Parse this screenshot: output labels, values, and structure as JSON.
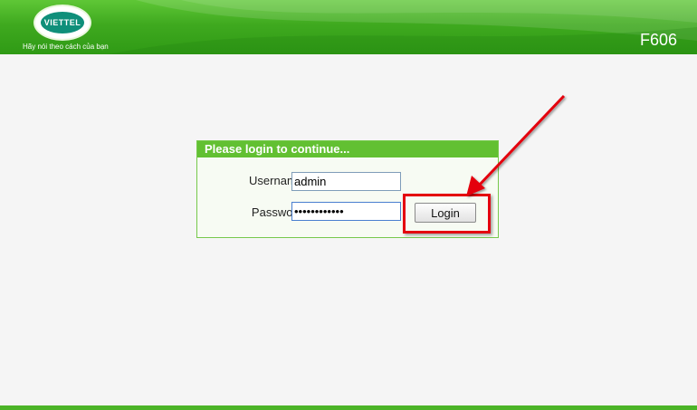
{
  "header": {
    "logo_text": "VIETTEL",
    "tagline": "Hãy nói theo cách của bạn",
    "model": "F606"
  },
  "login": {
    "title": "Please login to continue...",
    "username_label": "Username",
    "username_value": "admin",
    "password_label": "Password",
    "password_value": "••••••••••••",
    "login_button": "Login"
  },
  "colors": {
    "brand_green": "#3fa91f",
    "panel_green": "#62c032",
    "annotation_red": "#e4000f"
  }
}
